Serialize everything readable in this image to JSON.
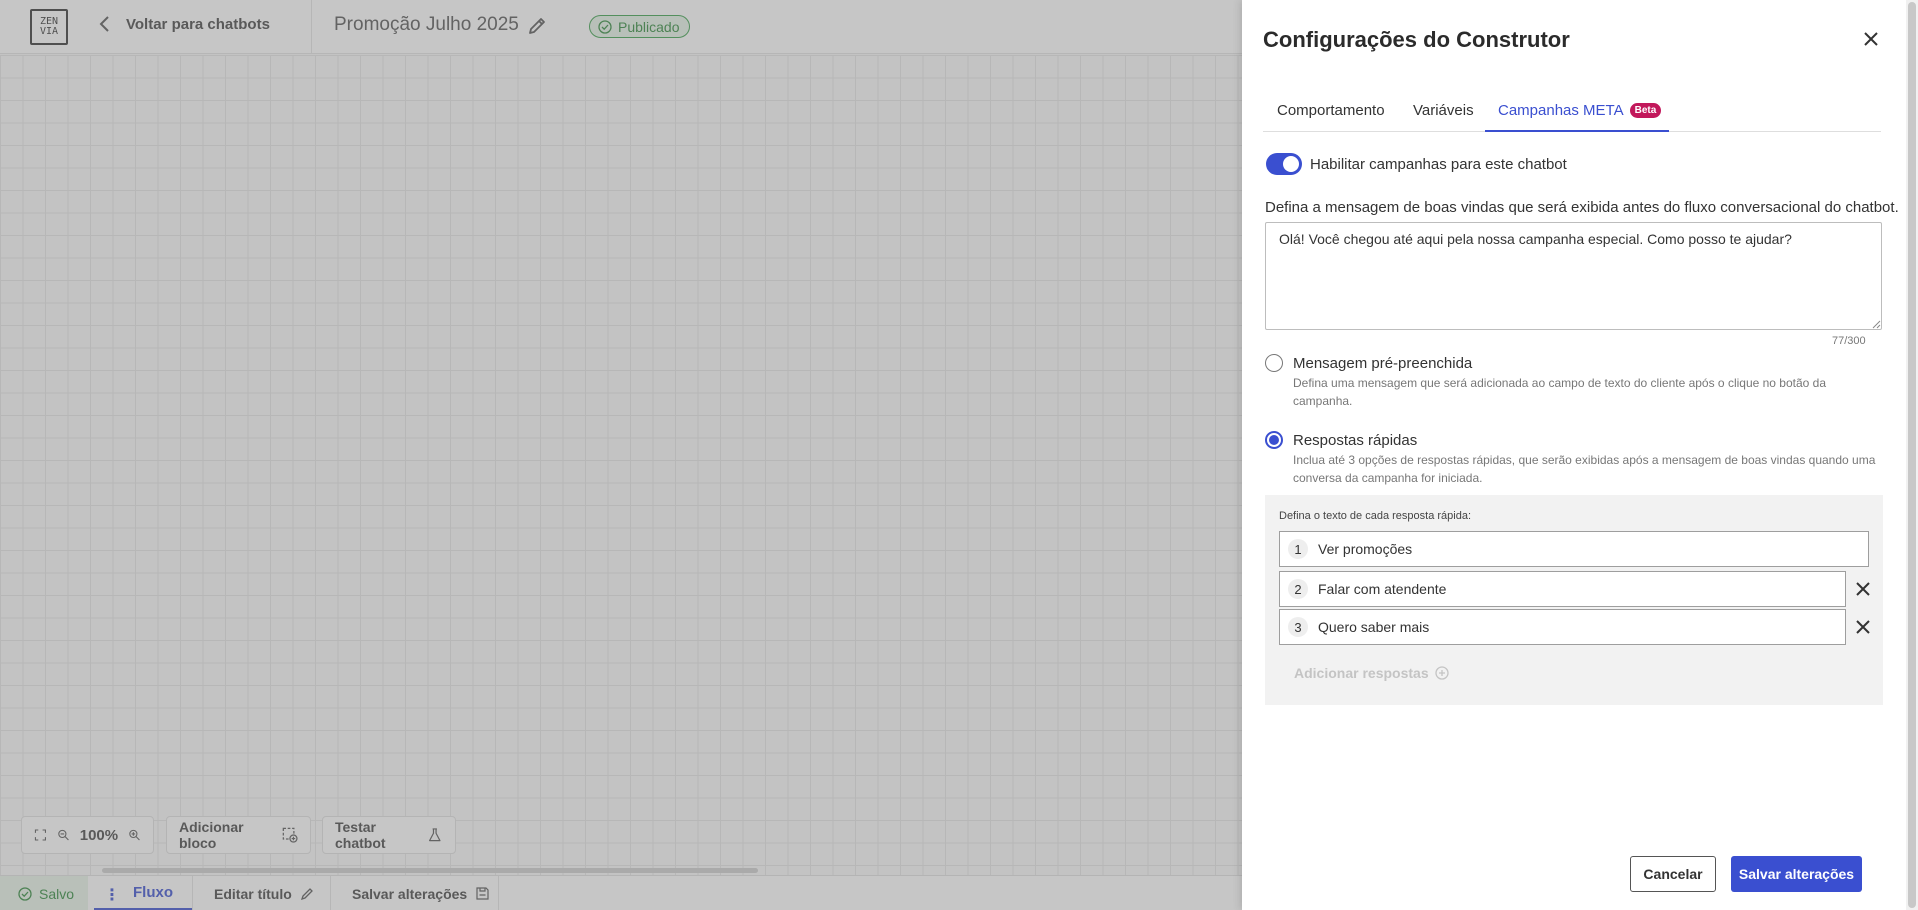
{
  "header": {
    "logo_text": "ZEN VIA",
    "back_label": "Voltar para chatbots",
    "flow_title": "Promoção Julho 2025",
    "status": "Publicado"
  },
  "canvas_tools": {
    "zoom_level": "100%",
    "add_block_label": "Adicionar bloco",
    "test_chatbot_label": "Testar chatbot"
  },
  "bottom_bar": {
    "saved_label": "Salvo",
    "active_tab": "Fluxo",
    "edit_title_label": "Editar título",
    "save_changes_label": "Salvar alterações"
  },
  "drawer": {
    "title": "Configurações do Construtor",
    "tabs": [
      {
        "label": "Comportamento"
      },
      {
        "label": "Variáveis"
      },
      {
        "label": "Campanhas META",
        "badge": "Beta",
        "active": true
      }
    ],
    "toggle_label": "Habilitar campanhas para este chatbot",
    "toggle_on": true,
    "welcome_label": "Defina a mensagem de boas vindas que será exibida antes do fluxo conversacional do chatbot.",
    "welcome_message": "Olá! Você chegou até aqui pela nossa campanha especial. Como posso te ajudar?",
    "char_counter": "77/300",
    "options": [
      {
        "title": "Mensagem pré-preenchida",
        "description": "Defina uma mensagem que será adicionada ao campo de texto do cliente após o clique no botão da campanha.",
        "selected": false
      },
      {
        "title": "Respostas rápidas",
        "description": "Inclua até 3 opções de respostas rápidas, que serão exibidas após a mensagem de boas vindas quando uma conversa da campanha for iniciada.",
        "selected": true
      }
    ],
    "quick_replies_label": "Defina o texto de cada resposta rápida:",
    "quick_replies": [
      {
        "number": "1",
        "text": "Ver promoções"
      },
      {
        "number": "2",
        "text": "Falar com atendente"
      },
      {
        "number": "3",
        "text": "Quero saber mais"
      }
    ],
    "add_replies_label": "Adicionar respostas",
    "cancel_label": "Cancelar",
    "save_label": "Salvar alterações"
  },
  "colors": {
    "accent": "#3a4fd0",
    "success": "#2f8a3c",
    "beta_badge": "#c2185b"
  }
}
